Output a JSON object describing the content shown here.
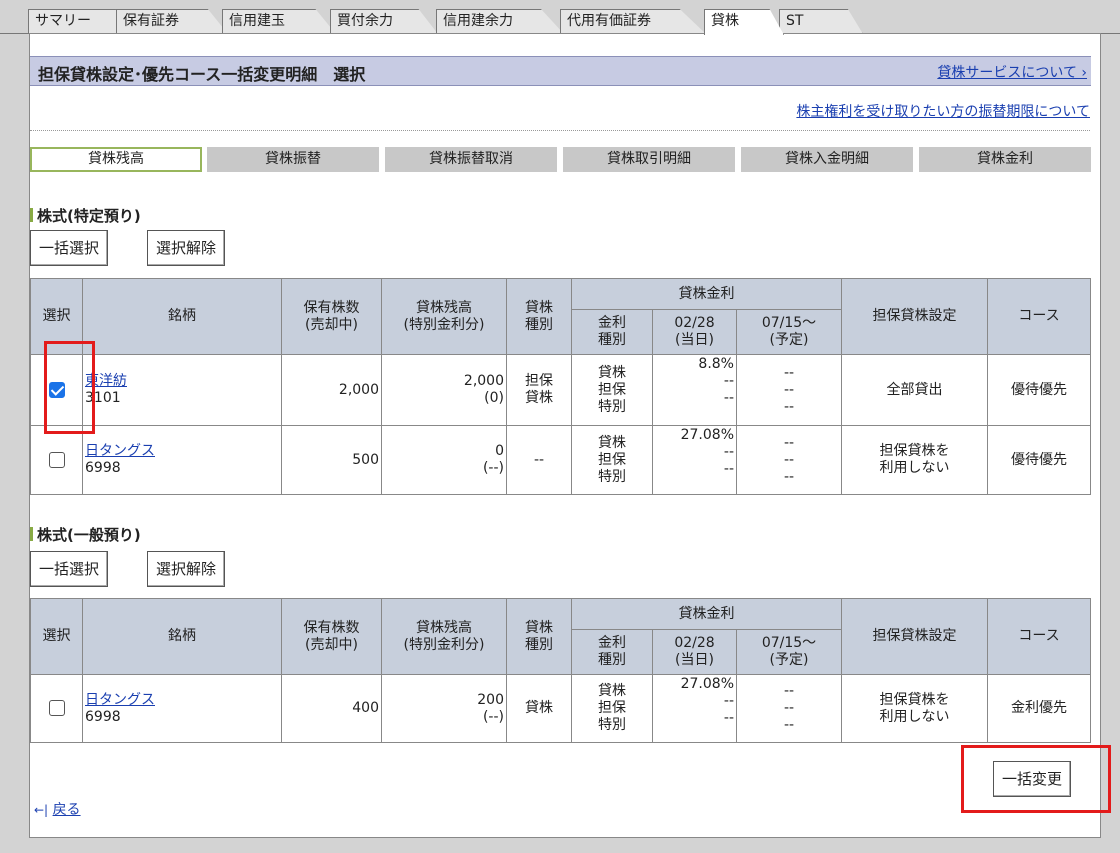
{
  "tabs": [
    {
      "label": "サマリー",
      "active": false
    },
    {
      "label": "保有証券",
      "active": false
    },
    {
      "label": "信用建玉",
      "active": false
    },
    {
      "label": "買付余力",
      "active": false
    },
    {
      "label": "信用建余力",
      "active": false
    },
    {
      "label": "代用有価証券",
      "active": false
    },
    {
      "label": "貸株",
      "active": true
    },
    {
      "label": "ST",
      "active": false
    }
  ],
  "page": {
    "title": "担保貸株設定･優先コース一括変更明細　選択",
    "service_link": "貸株サービスについて ›",
    "transfer_link": "株主権利を受け取りたい方の振替期限について"
  },
  "subtabs": [
    "貸株残高",
    "貸株振替",
    "貸株振替取消",
    "貸株取引明細",
    "貸株入金明細",
    "貸株金利"
  ],
  "buttons": {
    "select_all": "一括選択",
    "deselect": "選択解除",
    "bulk_change": "一括変更"
  },
  "table_headers": {
    "select": "選択",
    "name": "銘柄",
    "holdings_1": "保有株数",
    "holdings_2": "(売却中)",
    "balance_1": "貸株残高",
    "balance_2": "(特別金利分)",
    "type_1": "貸株",
    "type_2": "種別",
    "rate_group": "貸株金利",
    "rate_type_1": "金利",
    "rate_type_2": "種別",
    "rate_today_1": "02/28",
    "rate_today_2": "(当日)",
    "rate_plan_1": "07/15～",
    "rate_plan_2": "(予定)",
    "setting": "担保貸株設定",
    "course": "コース"
  },
  "sections": [
    {
      "heading": "株式(特定預り)",
      "rows": [
        {
          "checked": true,
          "name": "東洋紡",
          "code": "3101",
          "holdings": "2,000",
          "balance": "2,000",
          "balance_sub": "(0)",
          "lend_type": "担保\n貸株",
          "rate_types": [
            "貸株",
            "担保",
            "特別"
          ],
          "rates_today": [
            "8.8%",
            "--",
            "--"
          ],
          "rates_plan": [
            "--",
            "--",
            "--"
          ],
          "setting": "全部貸出",
          "course": "優待優先"
        },
        {
          "checked": false,
          "name": "日タングス",
          "code": "6998",
          "holdings": "500",
          "balance": "0",
          "balance_sub": "(--)",
          "lend_type": "--",
          "rate_types": [
            "貸株",
            "担保",
            "特別"
          ],
          "rates_today": [
            "27.08%",
            "--",
            "--"
          ],
          "rates_plan": [
            "--",
            "--",
            "--"
          ],
          "setting": "担保貸株を\n利用しない",
          "course": "優待優先"
        }
      ]
    },
    {
      "heading": "株式(一般預り)",
      "rows": [
        {
          "checked": false,
          "name": "日タングス",
          "code": "6998",
          "holdings": "400",
          "balance": "200",
          "balance_sub": "(--)",
          "lend_type": "貸株",
          "rate_types": [
            "貸株",
            "担保",
            "特別"
          ],
          "rates_today": [
            "27.08%",
            "--",
            "--"
          ],
          "rates_plan": [
            "--",
            "--",
            "--"
          ],
          "setting": "担保貸株を\n利用しない",
          "course": "金利優先"
        }
      ]
    }
  ],
  "back_link": "戻る",
  "back_icon": "arrow-left-icon",
  "colors": {
    "title_bar": "#c7cbe3",
    "header_cell": "#c7cfdc",
    "highlight": "#e31b1b",
    "link": "#1a3fb0",
    "active_subtab": "#98b65c"
  }
}
